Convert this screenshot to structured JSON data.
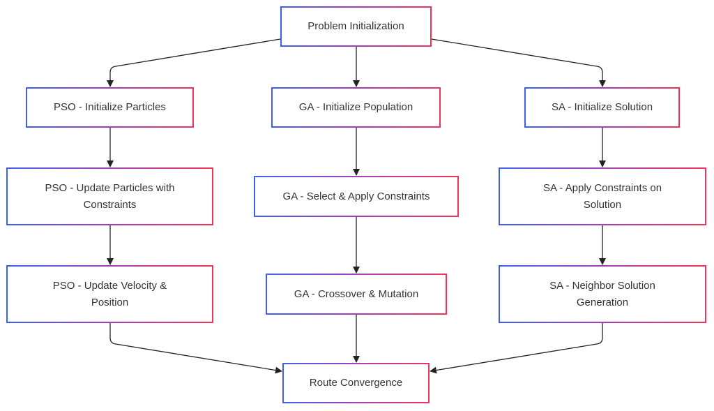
{
  "diagram": {
    "nodes": {
      "start": "Problem Initialization",
      "pso_init": "PSO - Initialize Particles",
      "ga_init": "GA - Initialize Population",
      "sa_init": "SA - Initialize Solution",
      "pso_update": "PSO - Update Particles with Constraints",
      "ga_select": "GA - Select & Apply Constraints",
      "sa_apply": "SA - Apply Constraints on Solution",
      "pso_velocity": "PSO - Update Velocity & Position",
      "ga_crossover": "GA - Crossover & Mutation",
      "sa_neighbor": "SA - Neighbor Solution Generation",
      "end": "Route Convergence"
    },
    "edges": [
      [
        "start",
        "pso_init"
      ],
      [
        "start",
        "ga_init"
      ],
      [
        "start",
        "sa_init"
      ],
      [
        "pso_init",
        "pso_update"
      ],
      [
        "pso_update",
        "pso_velocity"
      ],
      [
        "pso_velocity",
        "end"
      ],
      [
        "ga_init",
        "ga_select"
      ],
      [
        "ga_select",
        "ga_crossover"
      ],
      [
        "ga_crossover",
        "end"
      ],
      [
        "sa_init",
        "sa_apply"
      ],
      [
        "sa_apply",
        "sa_neighbor"
      ],
      [
        "sa_neighbor",
        "end"
      ]
    ],
    "colors": {
      "border_start": "#3f5ff0",
      "border_end": "#f0345a",
      "edge": "#222222"
    }
  }
}
